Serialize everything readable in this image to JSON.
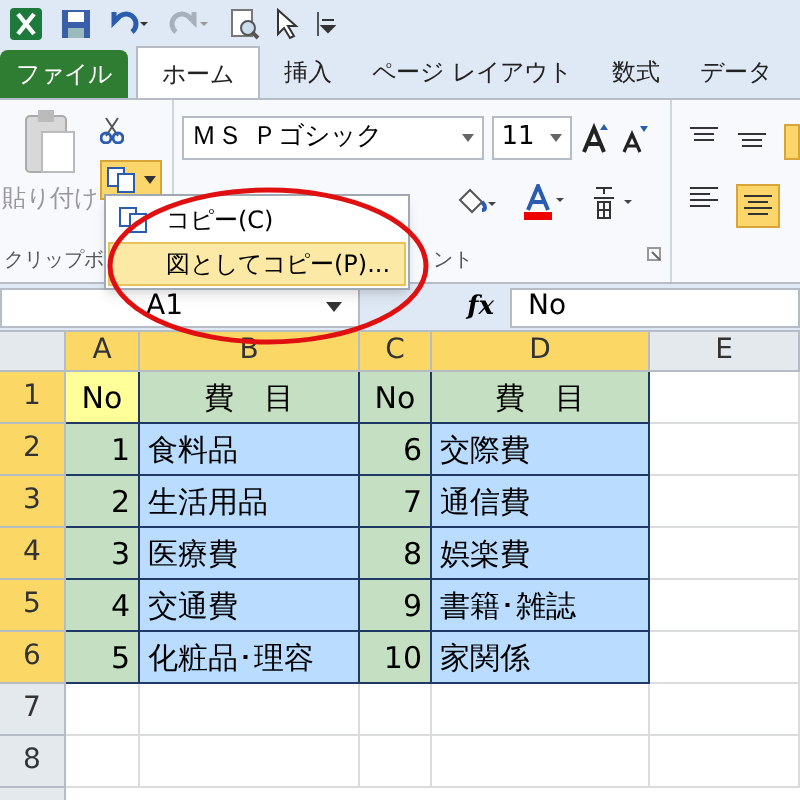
{
  "ribbon_tabs": [
    {
      "label": "ファイル",
      "kind": "file",
      "selected": false
    },
    {
      "label": "ホーム",
      "kind": "tab",
      "selected": true
    },
    {
      "label": "挿入",
      "kind": "tab",
      "selected": false
    },
    {
      "label": "ページ レイアウト",
      "kind": "tab",
      "selected": false
    },
    {
      "label": "数式",
      "kind": "tab",
      "selected": false
    },
    {
      "label": "データ",
      "kind": "tab",
      "selected": false
    }
  ],
  "clipboard": {
    "paste_label": "貼り付け",
    "group_label": "クリップボ"
  },
  "font_group": {
    "font_name": "ＭＳ Ｐゴシック",
    "font_size": "11",
    "group_label": "ント"
  },
  "copy_menu": [
    {
      "label": "コピー(C)",
      "selected": false
    },
    {
      "label": "図としてコピー(P)...",
      "selected": true
    }
  ],
  "name_box": "A1",
  "fx_label": "fx",
  "formula": "No",
  "columns": [
    {
      "label": "A",
      "selected": true
    },
    {
      "label": "B",
      "selected": true
    },
    {
      "label": "C",
      "selected": true
    },
    {
      "label": "D",
      "selected": true
    },
    {
      "label": "E",
      "selected": false
    }
  ],
  "rows": [
    {
      "header": "1",
      "selected": true,
      "cells": [
        {
          "text": "No",
          "kind": "center",
          "color": "#ffff99"
        },
        {
          "text": "費　目",
          "kind": "center",
          "color": "#c4dfc1"
        },
        {
          "text": "No",
          "kind": "center",
          "color": "#c4dfc1"
        },
        {
          "text": "費　目",
          "kind": "center",
          "color": "#c4dfc1"
        }
      ]
    },
    {
      "header": "2",
      "selected": true,
      "cells": [
        {
          "text": "1",
          "kind": "number",
          "color": "#c4dfc1"
        },
        {
          "text": "食料品",
          "kind": "text",
          "color": "#b9dcff"
        },
        {
          "text": "6",
          "kind": "number",
          "color": "#c4dfc1"
        },
        {
          "text": "交際費",
          "kind": "text",
          "color": "#b9dcff"
        }
      ]
    },
    {
      "header": "3",
      "selected": true,
      "cells": [
        {
          "text": "2",
          "kind": "number",
          "color": "#c4dfc1"
        },
        {
          "text": "生活用品",
          "kind": "text",
          "color": "#b9dcff"
        },
        {
          "text": "7",
          "kind": "number",
          "color": "#c4dfc1"
        },
        {
          "text": "通信費",
          "kind": "text",
          "color": "#b9dcff"
        }
      ]
    },
    {
      "header": "4",
      "selected": true,
      "cells": [
        {
          "text": "3",
          "kind": "number",
          "color": "#c4dfc1"
        },
        {
          "text": "医療費",
          "kind": "text",
          "color": "#b9dcff"
        },
        {
          "text": "8",
          "kind": "number",
          "color": "#c4dfc1"
        },
        {
          "text": "娯楽費",
          "kind": "text",
          "color": "#b9dcff"
        }
      ]
    },
    {
      "header": "5",
      "selected": true,
      "cells": [
        {
          "text": "4",
          "kind": "number",
          "color": "#c4dfc1"
        },
        {
          "text": "交通費",
          "kind": "text",
          "color": "#b9dcff"
        },
        {
          "text": "9",
          "kind": "number",
          "color": "#c4dfc1"
        },
        {
          "text": "書籍･雑誌",
          "kind": "text",
          "color": "#b9dcff"
        }
      ]
    },
    {
      "header": "6",
      "selected": true,
      "cells": [
        {
          "text": "5",
          "kind": "number",
          "color": "#c4dfc1"
        },
        {
          "text": "化粧品･理容",
          "kind": "text",
          "color": "#b9dcff"
        },
        {
          "text": "10",
          "kind": "number",
          "color": "#c4dfc1"
        },
        {
          "text": "家関係",
          "kind": "text",
          "color": "#b9dcff"
        }
      ]
    },
    {
      "header": "7",
      "selected": false,
      "cells": []
    },
    {
      "header": "8",
      "selected": false,
      "cells": []
    }
  ]
}
